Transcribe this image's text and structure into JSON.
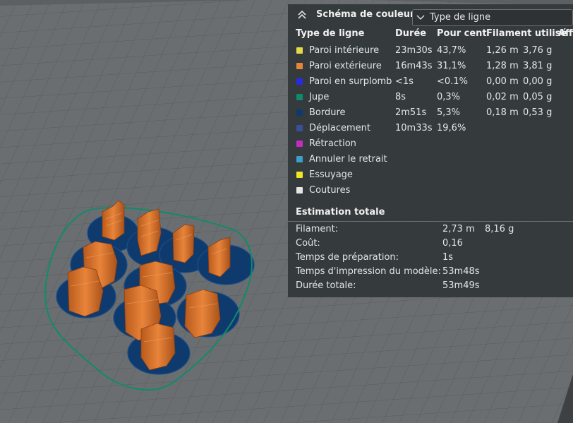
{
  "color_scheme": {
    "title": "Schéma de couleur",
    "selected_view": "Type de ligne"
  },
  "table": {
    "headers": [
      "Type de ligne",
      "Durée",
      "Pour cent",
      "Filament utilisé",
      "Affi"
    ],
    "rows": [
      {
        "label": "Paroi intérieure",
        "color": "#e6d84a",
        "duration": "23m30s",
        "percent": "43,7%",
        "length": "1,26 m",
        "weight": "3,76 g"
      },
      {
        "label": "Paroi extérieure",
        "color": "#e8843a",
        "duration": "16m43s",
        "percent": "31,1%",
        "length": "1,28 m",
        "weight": "3,81 g"
      },
      {
        "label": "Paroi en surplomb",
        "color": "#2a2ae6",
        "duration": "<1s",
        "percent": "<0.1%",
        "length": "0,00 m",
        "weight": "0,00 g"
      },
      {
        "label": "Jupe",
        "color": "#0e8c6a",
        "duration": "8s",
        "percent": "0,3%",
        "length": "0,02 m",
        "weight": "0,05 g"
      },
      {
        "label": "Bordure",
        "color": "#0f3a6e",
        "duration": "2m51s",
        "percent": "5,3%",
        "length": "0,18 m",
        "weight": "0,53 g"
      },
      {
        "label": "Déplacement",
        "color": "#3a4e9a",
        "duration": "10m33s",
        "percent": "19,6%",
        "length": "",
        "weight": ""
      },
      {
        "label": "Rétraction",
        "color": "#c22cc2",
        "duration": "",
        "percent": "",
        "length": "",
        "weight": ""
      },
      {
        "label": "Annuler le retrait",
        "color": "#3aa0c8",
        "duration": "",
        "percent": "",
        "length": "",
        "weight": ""
      },
      {
        "label": "Essuyage",
        "color": "#f0e624",
        "duration": "",
        "percent": "",
        "length": "",
        "weight": ""
      },
      {
        "label": "Coutures",
        "color": "#e6e6e6",
        "duration": "",
        "percent": "",
        "length": "",
        "weight": ""
      }
    ]
  },
  "summary": {
    "title": "Estimation totale",
    "rows": [
      {
        "label": "Filament:",
        "value": "2,73 m",
        "value2": "8,16 g"
      },
      {
        "label": "Coût:",
        "value": "0,16",
        "value2": ""
      },
      {
        "label": "Temps de préparation:",
        "value": "1s",
        "value2": ""
      },
      {
        "label": "Temps d'impression du modèle:",
        "value": "53m48s",
        "value2": ""
      },
      {
        "label": "Durée totale:",
        "value": "53m49s",
        "value2": ""
      }
    ]
  },
  "colors": {
    "plate": "#6b6e70",
    "grid": "#555859",
    "grid_major": "#4a4d4f",
    "skirt": "#0e8c6a",
    "brim": "#0f3a6e",
    "wall": "#e8843a"
  }
}
